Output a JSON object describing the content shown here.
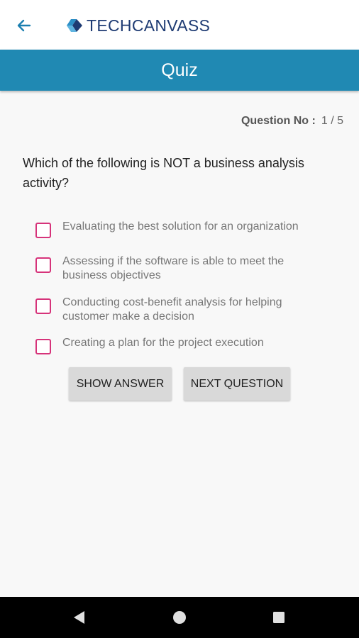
{
  "header": {
    "logo_text_light": "TECH",
    "logo_text_bold": "CANVASS",
    "brand_color": "#1e3b73"
  },
  "titlebar": {
    "title": "Quiz",
    "color": "#2089b3"
  },
  "quiz": {
    "question_no_label": "Question No :",
    "question_no_value": "1 / 5",
    "question": "Which of the following is NOT a business analysis activity?",
    "options": [
      {
        "label": "Evaluating the best solution for an organization",
        "checked": false
      },
      {
        "label": "Assessing if the software is able to meet the business objectives",
        "checked": false
      },
      {
        "label": "Conducting cost-benefit analysis for helping customer make a decision",
        "checked": false
      },
      {
        "label": "Creating a plan for the project execution",
        "checked": false
      }
    ],
    "checkbox_color": "#d6337a"
  },
  "actions": {
    "show_answer": "SHOW ANSWER",
    "next_question": "NEXT QUESTION"
  },
  "navbar": {
    "icons": [
      "back-triangle-icon",
      "home-circle-icon",
      "recents-square-icon"
    ]
  }
}
